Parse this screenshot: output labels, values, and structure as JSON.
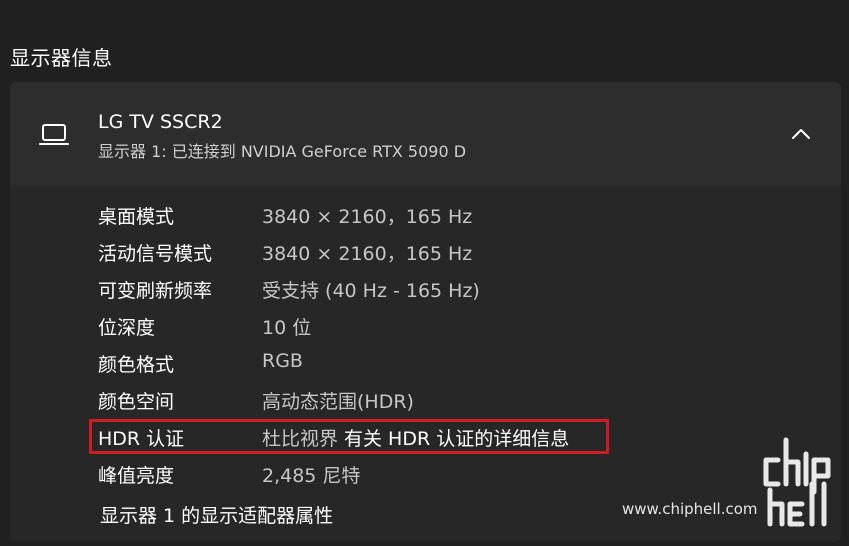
{
  "section": {
    "title": "显示器信息"
  },
  "display": {
    "name": "LG TV SSCR2",
    "subtitle": "显示器 1: 已连接到 NVIDIA GeForce RTX 5090 D",
    "icon": "laptop-icon",
    "expanded": true
  },
  "rows": [
    {
      "label": "桌面模式",
      "value": "3840 × 2160，165 Hz"
    },
    {
      "label": "活动信号模式",
      "value": "3840 × 2160，165 Hz"
    },
    {
      "label": "可变刷新频率",
      "value": "受支持 (40 Hz - 165 Hz)"
    },
    {
      "label": "位深度",
      "value": "10 位"
    },
    {
      "label": "颜色格式",
      "value": "RGB"
    },
    {
      "label": "颜色空间",
      "value": "高动态范围(HDR)"
    },
    {
      "label": "HDR 认证",
      "value": "杜比视界",
      "link": "有关 HDR 认证的详细信息"
    },
    {
      "label": "峰值亮度",
      "value": "2,485 尼特"
    }
  ],
  "adapter_link": "显示器 1 的显示适配器属性",
  "watermark": {
    "url": "www.chiphell.com"
  },
  "colors": {
    "background": "#202020",
    "card": "#272727",
    "header": "#2d2d2d",
    "highlight": "#d01b24"
  }
}
